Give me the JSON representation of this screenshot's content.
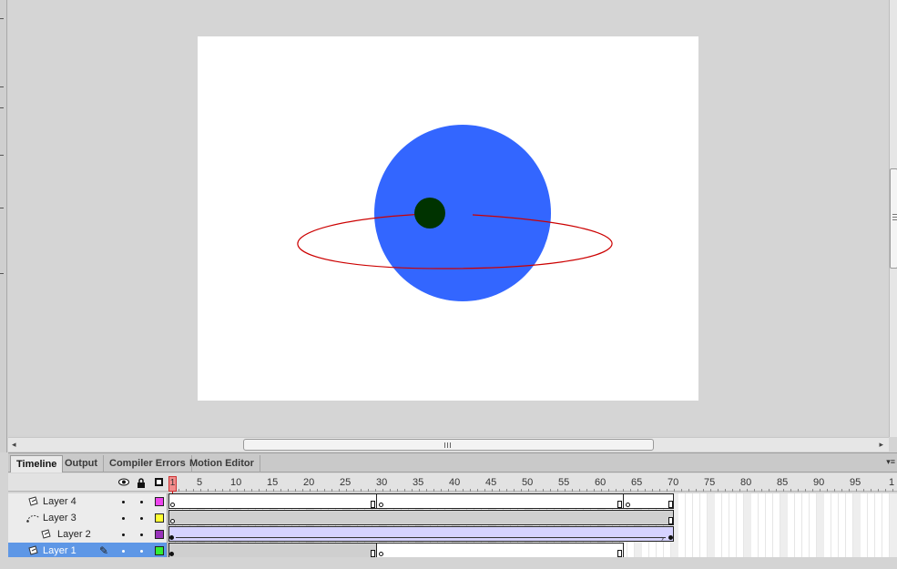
{
  "colors": {
    "stage_bg": "#ffffff",
    "planet": "#3366ff",
    "moon": "#003300",
    "orbit": "#cc0000",
    "selected_layer": "#5e97e6",
    "tween_frames": "#d6d3ff"
  },
  "stage_objects": [
    "planet-circle",
    "moon-circle",
    "orbit-path-ellipse"
  ],
  "tabs": [
    {
      "label": "Timeline",
      "active": true
    },
    {
      "label": "Output",
      "active": false
    },
    {
      "label": "Compiler Errors",
      "active": false
    },
    {
      "label": "Motion Editor",
      "active": false
    }
  ],
  "header_icons": [
    "eye-icon",
    "lock-icon",
    "outline-icon"
  ],
  "ruler": {
    "labels": [
      "1",
      "5",
      "10",
      "15",
      "20",
      "25",
      "30",
      "35",
      "40",
      "45",
      "50",
      "55",
      "60",
      "65",
      "70",
      "75",
      "80",
      "85",
      "90",
      "95",
      "1"
    ],
    "current_frame": "1"
  },
  "layers": [
    {
      "name": "Layer 4",
      "color": "#ee44ee",
      "type": "normal",
      "selected": false
    },
    {
      "name": "Layer 3",
      "color": "#ffff33",
      "type": "guide",
      "selected": false
    },
    {
      "name": "Layer 2",
      "color": "#9933bb",
      "type": "guided",
      "selected": false
    },
    {
      "name": "Layer 1",
      "color": "#33ee33",
      "type": "normal",
      "selected": true
    }
  ],
  "icons": {
    "panel_menu": "panel-menu-icon",
    "pencil": "pencil-icon",
    "scroll_left": "arrow-left-icon",
    "scroll_right": "arrow-right-icon"
  }
}
